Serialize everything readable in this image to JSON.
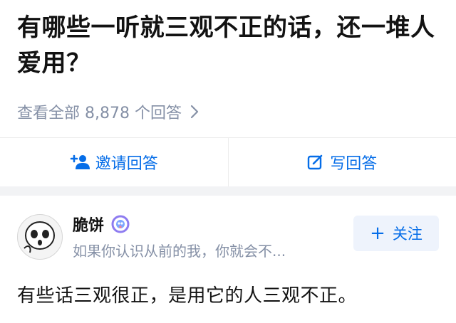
{
  "question": {
    "title": "有哪些一听就三观不正的话，还一堆人爱用？",
    "view_all_label": "查看全部 8,878 个回答"
  },
  "actions": {
    "invite_label": "邀请回答",
    "write_label": "写回答"
  },
  "answer": {
    "author_name": "脆饼",
    "author_bio": "如果你认识从前的我，你就会不...",
    "follow_label": "关注",
    "text": "有些话三观很正，是用它的人三观不正。"
  },
  "colors": {
    "accent": "#056de8",
    "muted": "#8590a6",
    "follow_bg": "#eef3fc",
    "separator": "#f2f3f5"
  },
  "icons": {
    "view_all": "chevron-right-icon",
    "invite": "add-user-icon",
    "write": "edit-icon",
    "badge": "creator-badge-icon",
    "follow": "plus-icon"
  }
}
